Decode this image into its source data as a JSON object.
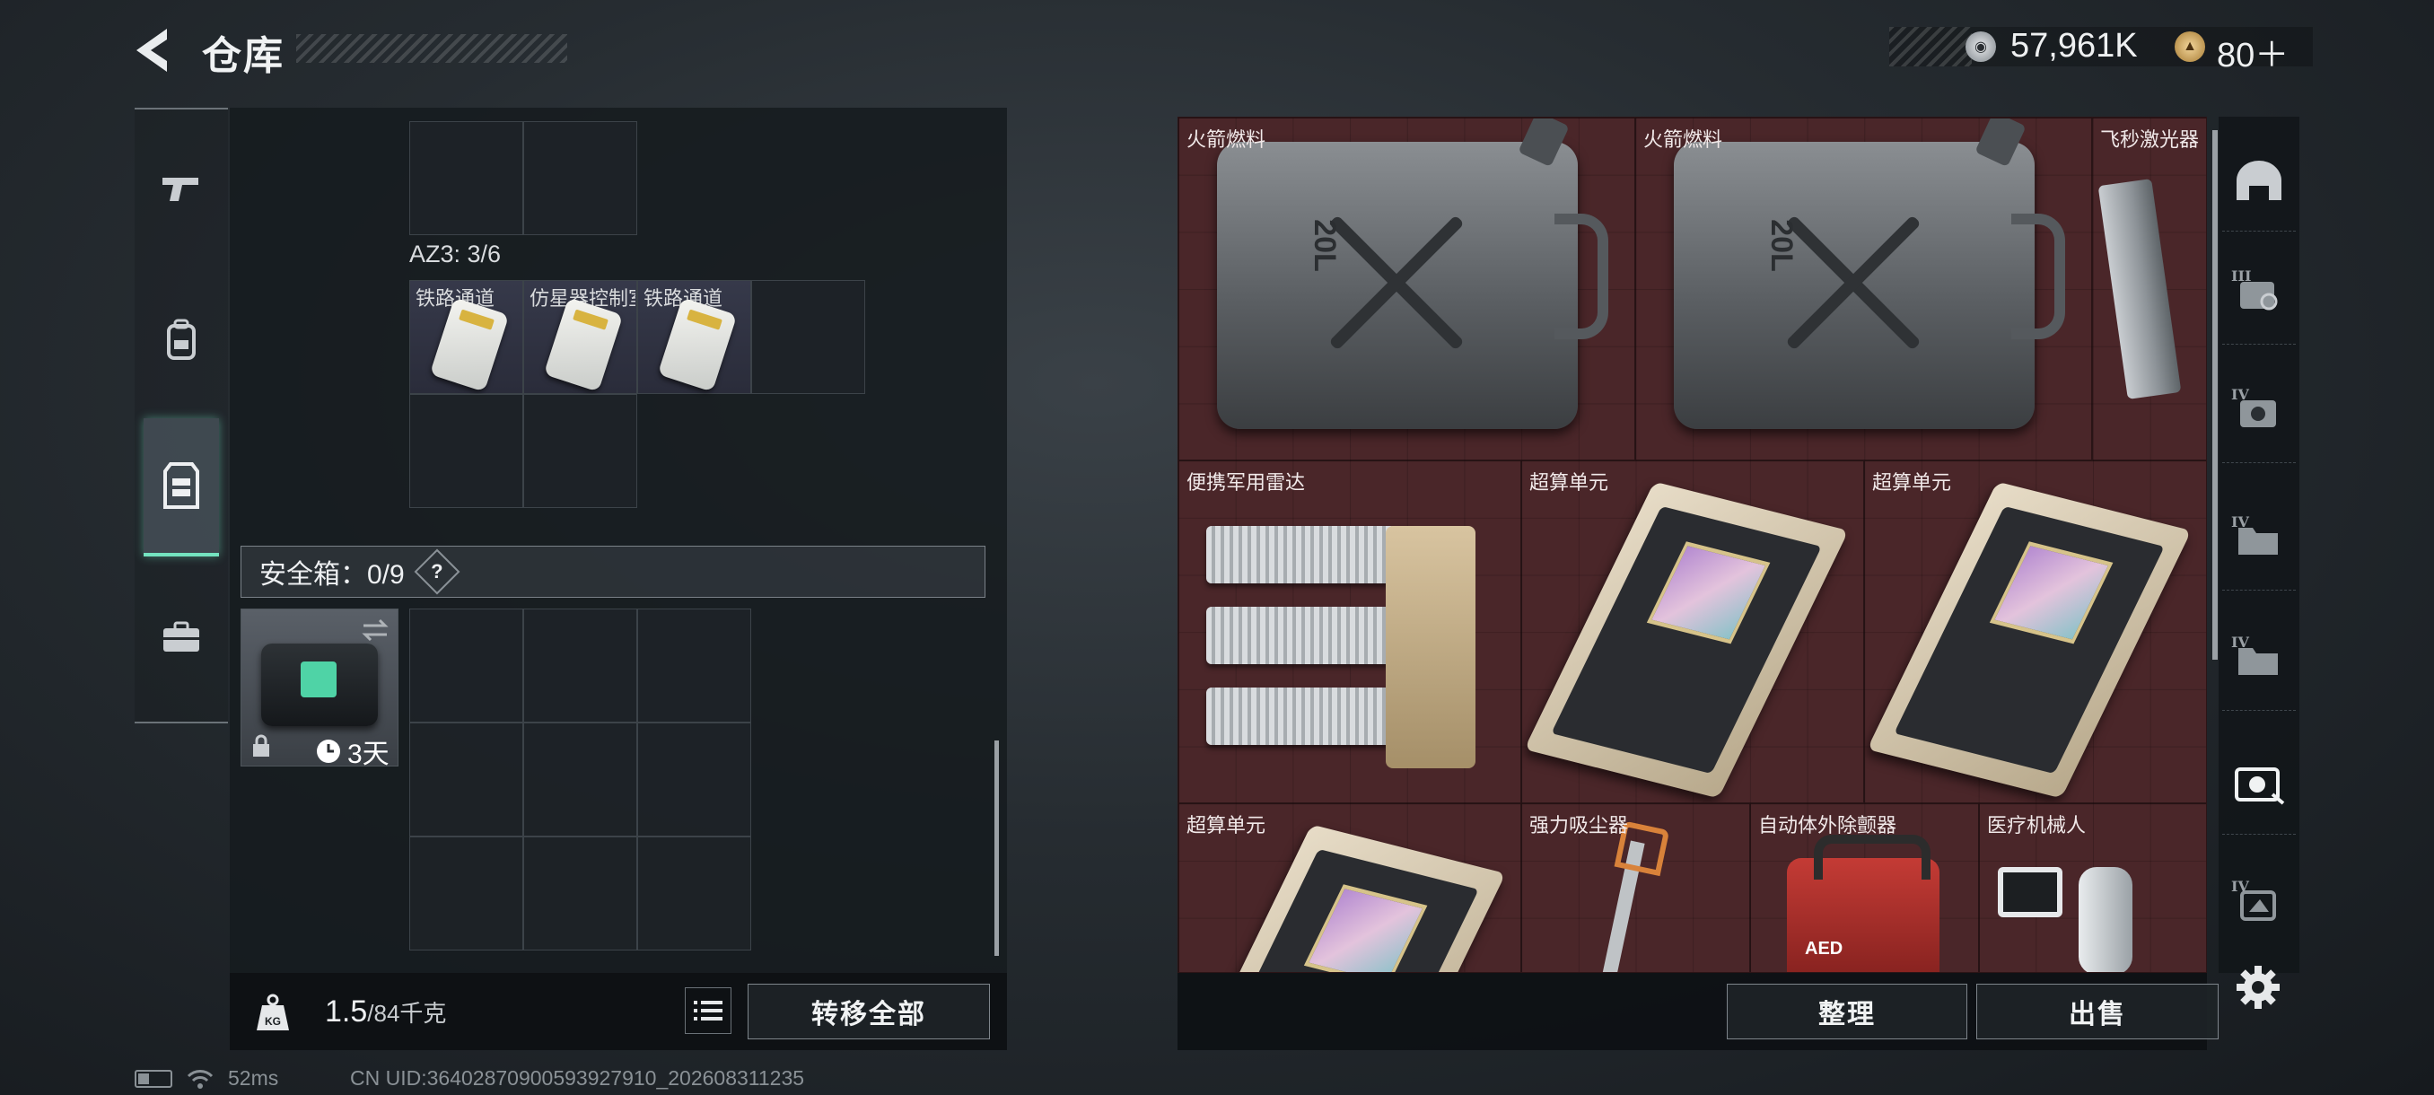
{
  "header": {
    "title": "仓库"
  },
  "currency": {
    "coins": "57,961K",
    "tokens": "80＋"
  },
  "left_tabs": [
    {
      "icon": "gun-icon"
    },
    {
      "icon": "backpack-icon"
    },
    {
      "icon": "vest-icon",
      "active": true
    },
    {
      "icon": "case-icon"
    }
  ],
  "container": {
    "section_label": "AZ3: 3/6",
    "items": [
      {
        "label": "铁路通道"
      },
      {
        "label": "仿星器控制室门禁"
      },
      {
        "label": "铁路通道"
      }
    ]
  },
  "safe_box": {
    "label": "安全箱：0/9",
    "help": "?",
    "timer": "3天",
    "locked": true
  },
  "footer_left": {
    "weight_icon": "KG",
    "weight_current": "1.5",
    "weight_max": "/84千克",
    "transfer_all": "转移全部"
  },
  "stash": {
    "items": [
      {
        "label": "火箭燃料",
        "can_text": "20L"
      },
      {
        "label": "火箭燃料",
        "can_text": "20L"
      },
      {
        "label": "飞秒激光器"
      },
      {
        "label": "便携军用雷达"
      },
      {
        "label": "超算单元"
      },
      {
        "label": "超算单元"
      },
      {
        "label": "超算单元"
      },
      {
        "label": "强力吸尘器"
      },
      {
        "label": "自动体外除颤器",
        "device_text": "AED"
      },
      {
        "label": "医疗机械人"
      }
    ],
    "sort": "整理",
    "sell": "出售"
  },
  "right_tabs": [
    {
      "icon": "helmet-icon"
    },
    {
      "icon": "tier3-filter-icon",
      "tier": "III"
    },
    {
      "icon": "tier4-filter-icon",
      "tier": "IV"
    },
    {
      "icon": "tier4-folder-icon",
      "tier": "IV"
    },
    {
      "icon": "tier4-folder-icon",
      "tier": "IV"
    },
    {
      "icon": "item-filter-icon",
      "active": true
    },
    {
      "icon": "tier4-misc-icon",
      "tier": "IV"
    }
  ],
  "status": {
    "ping": "52ms",
    "uid": "CN UID:364028709005939279​10_202608311235"
  },
  "colors": {
    "accent": "#74e3c0",
    "stash_bg": "#4a2629"
  }
}
